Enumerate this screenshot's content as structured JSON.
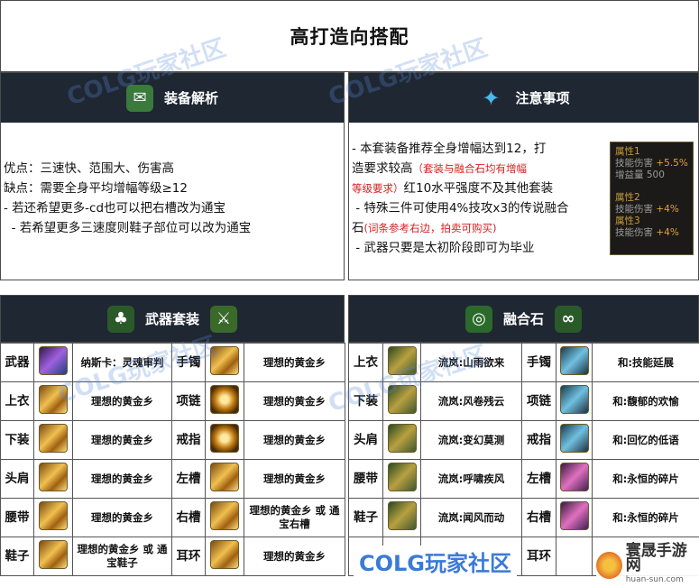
{
  "title": "高打造向搭配",
  "left_panel": {
    "header": "装备解析",
    "lines": [
      "优点：三速快、范围大、伤害高",
      "缺点：需要全身平均增幅等级≥12",
      "- 若还希望更多-cd也可以把右槽改为通宝",
      "  - 若希望更多三速度则鞋子部位可以改为通宝"
    ]
  },
  "right_panel": {
    "header": "注意事项",
    "line1a": "- 本套装备推荐全身增幅达到12，打",
    "line1b": "造要求较高",
    "note1a": "（套装与融合石均有增幅",
    "note1b": "等级要求）",
    "line1c": "红10水平强度不及其他套装",
    "line2a": " - 特殊三件可使用4%技攻x3的传说融合",
    "line2b": "石",
    "note2": "(词条参考右边，拍卖可购买)",
    "line3": " - 武器只要是太初阶段即可为毕业"
  },
  "attr_box": {
    "a1_title": "属性1",
    "a1_line1": "技能伤害",
    "a1_val1": "+5.5%",
    "a1_line2": "增益量",
    "a1_val2": "500",
    "a2_title": "属性2",
    "a2_line": "技能伤害",
    "a2_val": "+4%",
    "a3_title": "属性3",
    "a3_line": "技能伤害",
    "a3_val": "+4%"
  },
  "weapon_section": {
    "header": "武器套装",
    "rows": [
      {
        "slot": "武器",
        "name": "纳斯卡：灵魂审判",
        "slot2": "手镯",
        "name2": "理想的黄金乡"
      },
      {
        "slot": "上衣",
        "name": "理想的黄金乡",
        "slot2": "项链",
        "name2": "理想的黄金乡"
      },
      {
        "slot": "下装",
        "name": "理想的黄金乡",
        "slot2": "戒指",
        "name2": "理想的黄金乡"
      },
      {
        "slot": "头肩",
        "name": "理想的黄金乡",
        "slot2": "左槽",
        "name2": "理想的黄金乡"
      },
      {
        "slot": "腰带",
        "name": "理想的黄金乡",
        "slot2": "右槽",
        "name2": "理想的黄金乡 或 通宝右槽"
      },
      {
        "slot": "鞋子",
        "name": "理想的黄金乡 或 通宝鞋子",
        "slot2": "耳环",
        "name2": "理想的黄金乡"
      }
    ]
  },
  "fusion_section": {
    "header": "融合石",
    "rows": [
      {
        "slot": "上衣",
        "name": "流岚:山雨欲来",
        "slot2": "手镯",
        "name2": "和:技能延展"
      },
      {
        "slot": "下装",
        "name": "流岚:风卷残云",
        "slot2": "项链",
        "name2": "和:馥郁的欢愉"
      },
      {
        "slot": "头肩",
        "name": "流岚:变幻莫测",
        "slot2": "戒指",
        "name2": "和:回忆的低语"
      },
      {
        "slot": "腰带",
        "name": "流岚:呼啸疾风",
        "slot2": "左槽",
        "name2": "和:永恒的碎片"
      },
      {
        "slot": "鞋子",
        "name": "流岚:闻风而动",
        "slot2": "右槽",
        "name2": "和:永恒的碎片"
      },
      {
        "slot": "",
        "name": "",
        "slot2": "耳环",
        "name2": ""
      }
    ]
  },
  "watermarks": {
    "w1": "COLG玩家社区",
    "w2": "COLG玩家社区",
    "w3": "COLG玩家社区",
    "w4": "COLG玩家社区"
  },
  "logo_bottom": "COLG玩家社区",
  "logo_corner": "寰晟手游网",
  "logo_corner_url": "huan-sun.com"
}
